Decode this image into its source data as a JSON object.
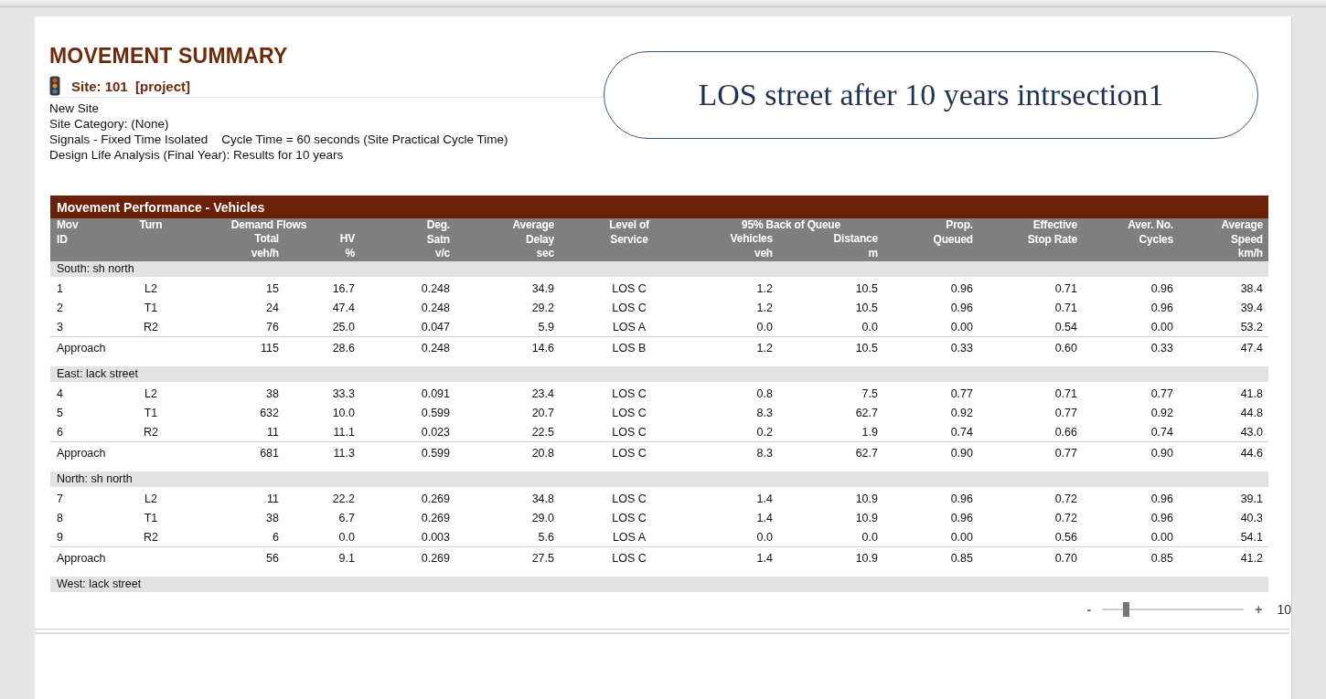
{
  "report": {
    "title": "MOVEMENT SUMMARY",
    "site": "Site: 101  [project]",
    "details": [
      "New Site",
      "Site Category: (None)",
      "Signals - Fixed Time Isolated    Cycle Time = 60 seconds (Site Practical Cycle Time)",
      "Design Life Analysis (Final Year): Results for 10 years"
    ]
  },
  "callout": {
    "text": "LOS street after 10 years intrsection1"
  },
  "table": {
    "title": "Movement Performance - Vehicles",
    "header": [
      {
        "title": [
          "Mov",
          "ID"
        ]
      },
      {
        "title": [
          "Turn"
        ]
      },
      {
        "group": "Demand Flows",
        "columns": [
          {
            "title": [
              "Total",
              "veh/h"
            ]
          },
          {
            "title": [
              "HV",
              "%"
            ]
          }
        ]
      },
      {
        "title": [
          "Deg.",
          "Satn",
          "v/c"
        ]
      },
      {
        "title": [
          "Average",
          "Delay",
          "sec"
        ]
      },
      {
        "title": [
          "Level of",
          "Service"
        ]
      },
      {
        "group": "95% Back of Queue",
        "columns": [
          {
            "title": [
              "Vehicles",
              "veh"
            ]
          },
          {
            "title": [
              "Distance",
              "m"
            ]
          }
        ]
      },
      {
        "title": [
          "Prop.",
          "Queued"
        ]
      },
      {
        "title": [
          "Effective",
          "Stop Rate"
        ]
      },
      {
        "title": [
          "Aver. No.",
          "Cycles"
        ]
      },
      {
        "title": [
          "Average",
          "Speed",
          "km/h"
        ]
      }
    ],
    "sections": [
      {
        "name": "South: sh north",
        "rows": [
          {
            "kind": "movement",
            "cells": [
              "1",
              "L2",
              "15",
              "16.7",
              "0.248",
              "34.9",
              "LOS C",
              "1.2",
              "10.5",
              "0.96",
              "0.71",
              "0.96",
              "38.4"
            ]
          },
          {
            "kind": "movement",
            "cells": [
              "2",
              "T1",
              "24",
              "47.4",
              "0.248",
              "29.2",
              "LOS C",
              "1.2",
              "10.5",
              "0.96",
              "0.71",
              "0.96",
              "39.4"
            ]
          },
          {
            "kind": "movement",
            "cells": [
              "3",
              "R2",
              "76",
              "25.0",
              "0.047",
              "5.9",
              "LOS A",
              "0.0",
              "0.0",
              "0.00",
              "0.54",
              "0.00",
              "53.2"
            ]
          },
          {
            "kind": "approach",
            "cells": [
              "Approach",
              "",
              "115",
              "28.6",
              "0.248",
              "14.6",
              "LOS B",
              "1.2",
              "10.5",
              "0.33",
              "0.60",
              "0.33",
              "47.4"
            ]
          }
        ]
      },
      {
        "name": "East: lack street",
        "rows": [
          {
            "kind": "movement",
            "cells": [
              "4",
              "L2",
              "38",
              "33.3",
              "0.091",
              "23.4",
              "LOS C",
              "0.8",
              "7.5",
              "0.77",
              "0.71",
              "0.77",
              "41.8"
            ]
          },
          {
            "kind": "movement",
            "cells": [
              "5",
              "T1",
              "632",
              "10.0",
              "0.599",
              "20.7",
              "LOS C",
              "8.3",
              "62.7",
              "0.92",
              "0.77",
              "0.92",
              "44.8"
            ]
          },
          {
            "kind": "movement",
            "cells": [
              "6",
              "R2",
              "11",
              "11.1",
              "0.023",
              "22.5",
              "LOS C",
              "0.2",
              "1.9",
              "0.74",
              "0.66",
              "0.74",
              "43.0"
            ]
          },
          {
            "kind": "approach",
            "cells": [
              "Approach",
              "",
              "681",
              "11.3",
              "0.599",
              "20.8",
              "LOS C",
              "8.3",
              "62.7",
              "0.90",
              "0.77",
              "0.90",
              "44.6"
            ]
          }
        ]
      },
      {
        "name": "North: sh north",
        "rows": [
          {
            "kind": "movement",
            "cells": [
              "7",
              "L2",
              "11",
              "22.2",
              "0.269",
              "34.8",
              "LOS C",
              "1.4",
              "10.9",
              "0.96",
              "0.72",
              "0.96",
              "39.1"
            ]
          },
          {
            "kind": "movement",
            "cells": [
              "8",
              "T1",
              "38",
              "6.7",
              "0.269",
              "29.0",
              "LOS C",
              "1.4",
              "10.9",
              "0.96",
              "0.72",
              "0.96",
              "40.3"
            ]
          },
          {
            "kind": "movement",
            "cells": [
              "9",
              "R2",
              "6",
              "0.0",
              "0.003",
              "5.6",
              "LOS A",
              "0.0",
              "0.0",
              "0.00",
              "0.56",
              "0.00",
              "54.1"
            ]
          },
          {
            "kind": "approach",
            "cells": [
              "Approach",
              "",
              "56",
              "9.1",
              "0.269",
              "27.5",
              "LOS C",
              "1.4",
              "10.9",
              "0.85",
              "0.70",
              "0.85",
              "41.2"
            ]
          }
        ]
      },
      {
        "name": "West: lack street"
      }
    ]
  },
  "zoom": {
    "minus": "-",
    "plus": "+",
    "percent": "10",
    "level": 0.17
  }
}
